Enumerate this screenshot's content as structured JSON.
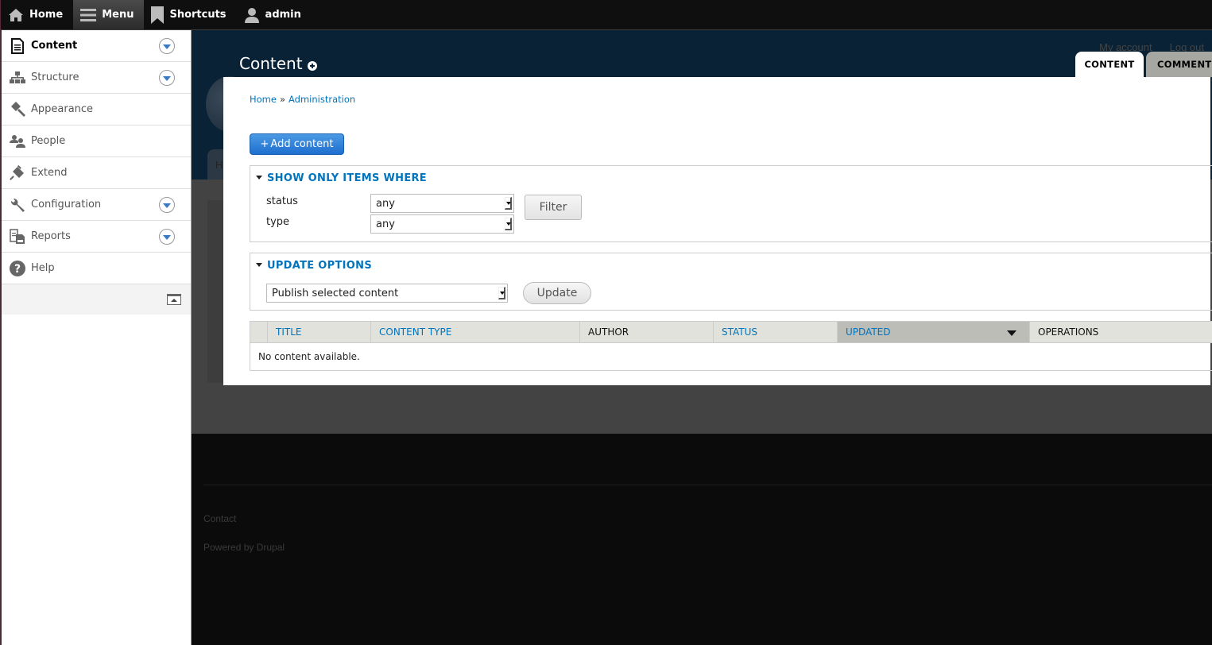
{
  "toolbar": {
    "items": [
      {
        "label": "Home",
        "icon": "home-icon"
      },
      {
        "label": "Menu",
        "icon": "hamburger-icon",
        "active": true
      },
      {
        "label": "Shortcuts",
        "icon": "bookmark-icon"
      },
      {
        "label": "admin",
        "icon": "user-icon"
      }
    ]
  },
  "tray": {
    "items": [
      {
        "label": "Content",
        "icon": "document-icon",
        "active": true,
        "expandable": true
      },
      {
        "label": "Structure",
        "icon": "sitemap-icon",
        "expandable": true
      },
      {
        "label": "Appearance",
        "icon": "paintbrush-icon"
      },
      {
        "label": "People",
        "icon": "people-icon"
      },
      {
        "label": "Extend",
        "icon": "plug-icon"
      },
      {
        "label": "Configuration",
        "icon": "wrench-icon",
        "expandable": true
      },
      {
        "label": "Reports",
        "icon": "reports-icon",
        "expandable": true
      },
      {
        "label": "Help",
        "icon": "help-icon"
      }
    ]
  },
  "site": {
    "links": [
      "My account",
      "Log out"
    ],
    "tab_partial": "H",
    "footer": {
      "contact": "Contact",
      "powered": "Powered by Drupal"
    }
  },
  "overlay": {
    "title": "Content",
    "tabs": [
      {
        "label": "CONTENT",
        "active": true
      },
      {
        "label": "COMMENTS"
      }
    ],
    "breadcrumb": {
      "home": "Home",
      "separator": "»",
      "admin": "Administration"
    },
    "add_button": {
      "plus": "+",
      "label": "Add content"
    },
    "filter": {
      "legend": "SHOW ONLY ITEMS WHERE",
      "status_label": "status",
      "status_value": "any",
      "type_label": "type",
      "type_value": "any",
      "button": "Filter"
    },
    "update": {
      "legend": "UPDATE OPTIONS",
      "action_value": "Publish selected content",
      "button": "Update"
    },
    "table": {
      "columns": [
        "TITLE",
        "CONTENT TYPE",
        "AUTHOR",
        "STATUS",
        "UPDATED",
        "OPERATIONS"
      ],
      "empty": "No content available."
    }
  },
  "colors": {
    "link": "#0074bd",
    "header_bg": "#0a2235",
    "primary_button": "#1e6fcf"
  }
}
